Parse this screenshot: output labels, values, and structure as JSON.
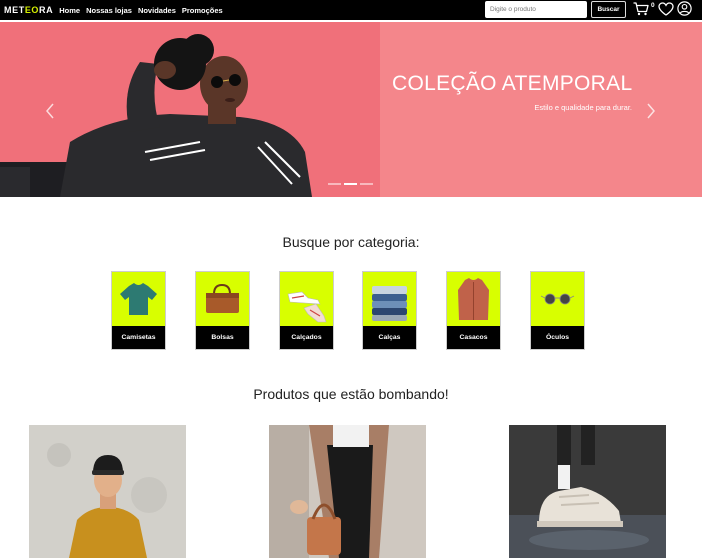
{
  "navbar": {
    "logo_main": "MET",
    "logo_accent": "EO",
    "logo_end": "RA",
    "links": [
      "Home",
      "Nossas lojas",
      "Novidades",
      "Promoções"
    ],
    "search_placeholder": "Digite o produto",
    "search_button": "Buscar",
    "cart_count": "0"
  },
  "hero": {
    "title": "COLEÇÃO ATEMPORAL",
    "subtitle": "Estilo e qualidade para durar.",
    "slides": 3,
    "active_slide": 1
  },
  "categories": {
    "heading": "Busque por categoria:",
    "items": [
      {
        "label": "Camisetas",
        "icon": "tshirt-icon"
      },
      {
        "label": "Bolsas",
        "icon": "bag-icon"
      },
      {
        "label": "Calçados",
        "icon": "shoe-icon"
      },
      {
        "label": "Calças",
        "icon": "pants-icon"
      },
      {
        "label": "Casacos",
        "icon": "coat-icon"
      },
      {
        "label": "Óculos",
        "icon": "glasses-icon"
      }
    ]
  },
  "products": {
    "heading": "Produtos que estão bombando!"
  },
  "colors": {
    "accent": "#d8ff00",
    "hero_bg": "#f4868b",
    "navbar_bg": "#000000"
  }
}
